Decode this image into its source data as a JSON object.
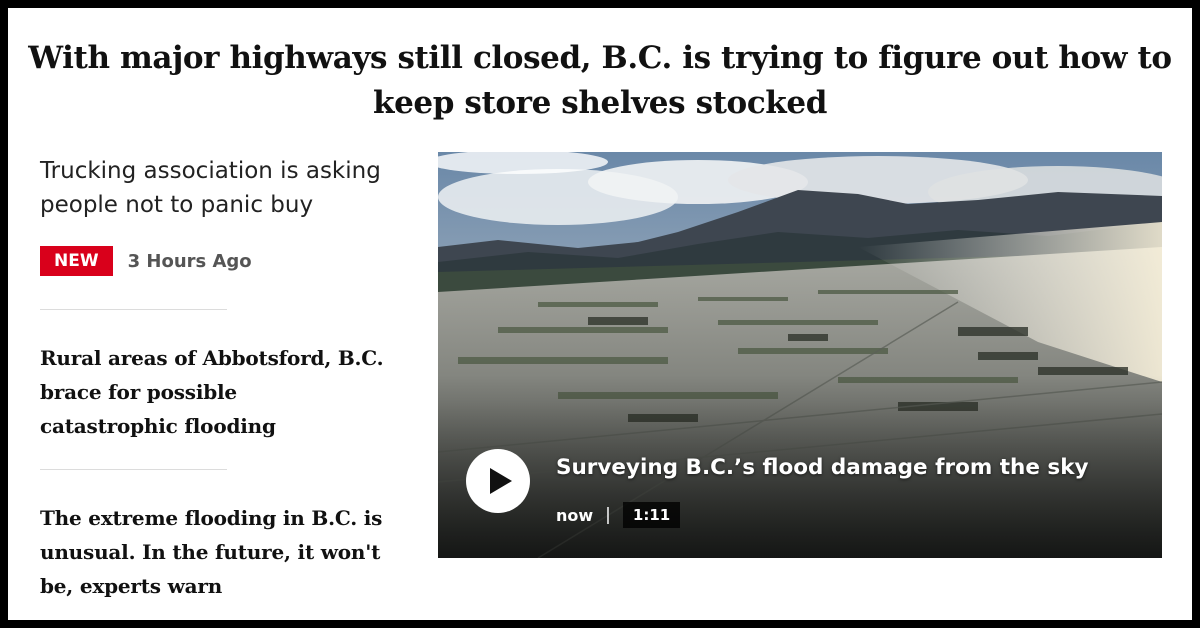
{
  "headline": {
    "line1": "With major highways still closed, B.C. is trying to figure out how to",
    "line2": "keep store shelves stocked"
  },
  "subhead": {
    "line1": "Trucking association is asking",
    "line2": "people not to panic buy"
  },
  "badge": "NEW",
  "timestamp": "3 Hours Ago",
  "stories": [
    {
      "lines": [
        "Rural areas of Abbotsford, B.C.",
        "brace for possible",
        "catastrophic flooding"
      ]
    },
    {
      "lines": [
        "The extreme flooding in B.C. is",
        "unusual. In the future, it won't",
        "be, experts warn"
      ]
    }
  ],
  "video": {
    "title": "Surveying B.C.’s flood damage from the sky",
    "status": "now",
    "separator": "|",
    "duration": "1:11",
    "icon": "play-icon"
  },
  "colors": {
    "badge": "#d9001b",
    "background": "#ffffff",
    "border": "#000000"
  }
}
